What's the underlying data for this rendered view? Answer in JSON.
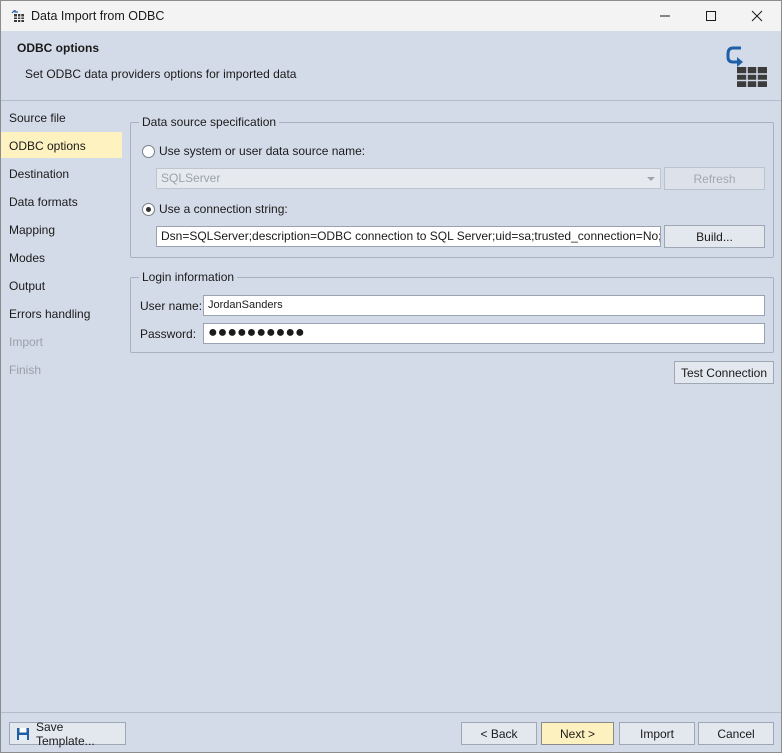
{
  "window": {
    "title": "Data Import from ODBC"
  },
  "header": {
    "title": "ODBC options",
    "subtitle": "Set ODBC data providers options for imported data"
  },
  "sidebar": {
    "items": [
      {
        "label": "Source file",
        "state": "normal"
      },
      {
        "label": "ODBC options",
        "state": "active"
      },
      {
        "label": "Destination",
        "state": "normal"
      },
      {
        "label": "Data formats",
        "state": "normal"
      },
      {
        "label": "Mapping",
        "state": "normal"
      },
      {
        "label": "Modes",
        "state": "normal"
      },
      {
        "label": "Output",
        "state": "normal"
      },
      {
        "label": "Errors handling",
        "state": "normal"
      },
      {
        "label": "Import",
        "state": "disabled"
      },
      {
        "label": "Finish",
        "state": "disabled"
      }
    ]
  },
  "datasource": {
    "group_title": "Data source specification",
    "radio_dsn_label": "Use system or user data source name:",
    "radio_dsn_checked": false,
    "dsn_value": "SQLServer",
    "refresh_label": "Refresh",
    "radio_conn_label": "Use a connection string:",
    "radio_conn_checked": true,
    "connection_string": "Dsn=SQLServer;description=ODBC connection to SQL Server;uid=sa;trusted_connection=No;app=Micr",
    "build_label": "Build..."
  },
  "login": {
    "group_title": "Login information",
    "username_label": "User name:",
    "username_value": "JordanSanders",
    "password_label": "Password:",
    "password_value": "●●●●●●●●●●"
  },
  "test_connection_label": "Test Connection",
  "footer": {
    "save_template_label": "Save Template...",
    "back_label": "< Back",
    "next_label": "Next >",
    "import_label": "Import",
    "cancel_label": "Cancel"
  }
}
